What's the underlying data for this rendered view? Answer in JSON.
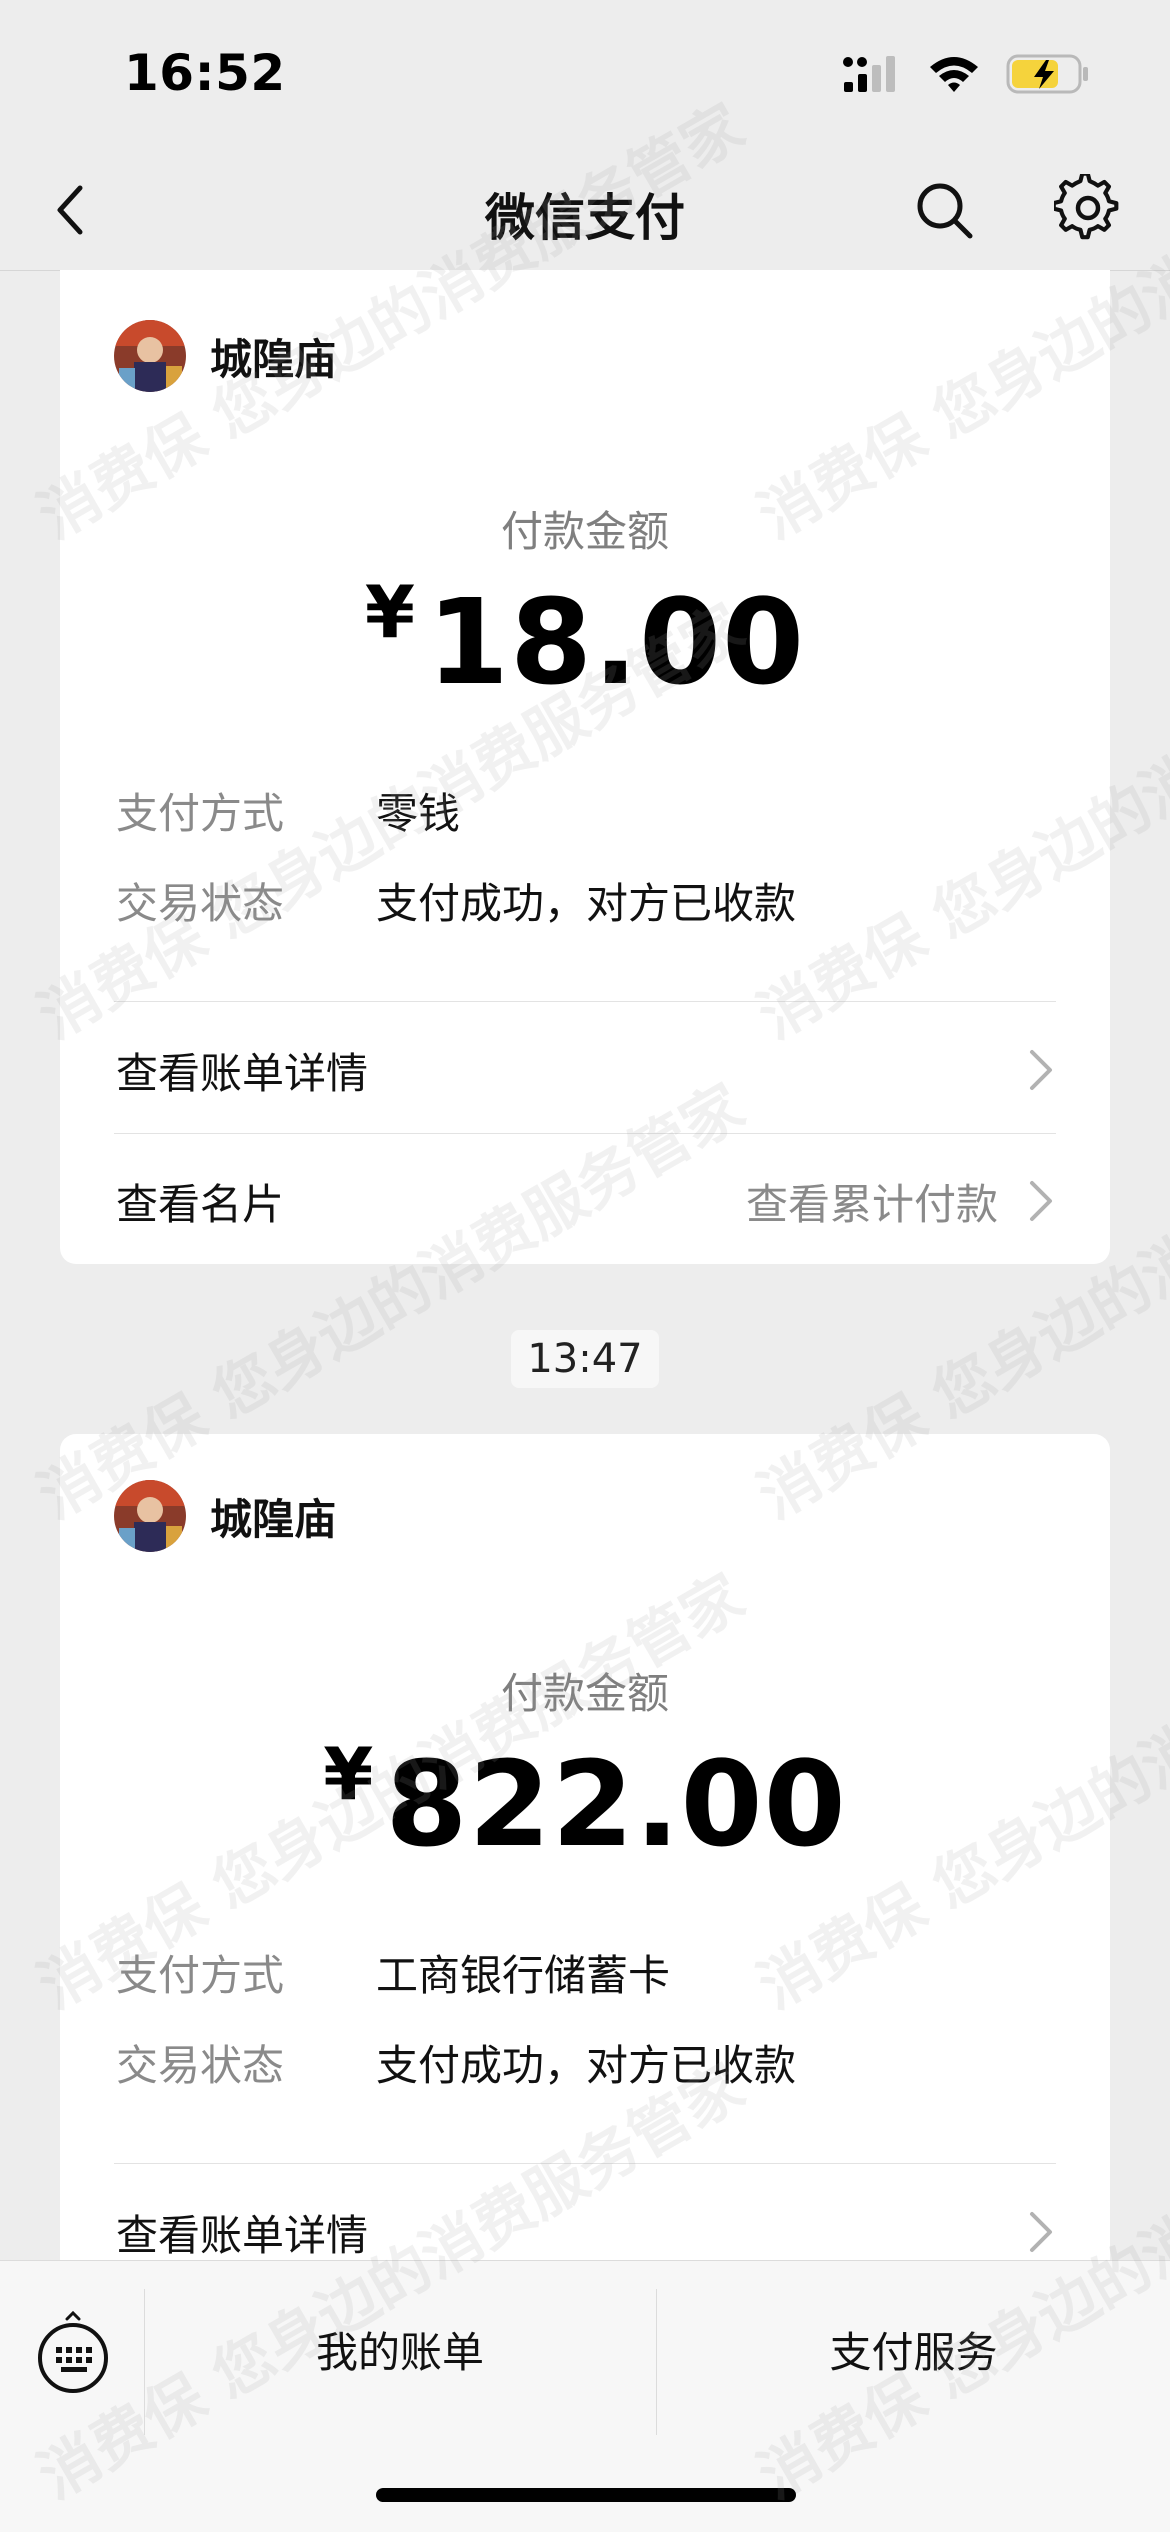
{
  "status_bar": {
    "time": "16:52"
  },
  "nav": {
    "title": "微信支付",
    "back_icon": "chevron-left-icon",
    "search_icon": "search-icon",
    "settings_icon": "gear-icon"
  },
  "payments": [
    {
      "merchant": "城隍庙",
      "amount_label": "付款金额",
      "currency": "¥",
      "amount": "18.00",
      "method_key": "支付方式",
      "method_value": "零钱",
      "status_key": "交易状态",
      "status_value": "支付成功，对方已收款",
      "bill_detail_link": "查看账单详情",
      "card_link": "查看名片",
      "cumulative_link": "查看累计付款"
    },
    {
      "merchant": "城隍庙",
      "amount_label": "付款金额",
      "currency": "¥",
      "amount": "822.00",
      "method_key": "支付方式",
      "method_value": "工商银行储蓄卡",
      "status_key": "交易状态",
      "status_value": "支付成功，对方已收款",
      "bill_detail_link": "查看账单详情"
    }
  ],
  "time_separator": "13:47",
  "bottom_bar": {
    "keyboard_icon": "keyboard-icon",
    "my_bills": "我的账单",
    "pay_services": "支付服务"
  },
  "watermark": {
    "text": "消费保 您身边的消费服务管家"
  },
  "colors": {
    "background": "#ededed",
    "card": "#ffffff",
    "secondary_text": "#8a8a8a",
    "battery_charging": "#f5d33c"
  }
}
